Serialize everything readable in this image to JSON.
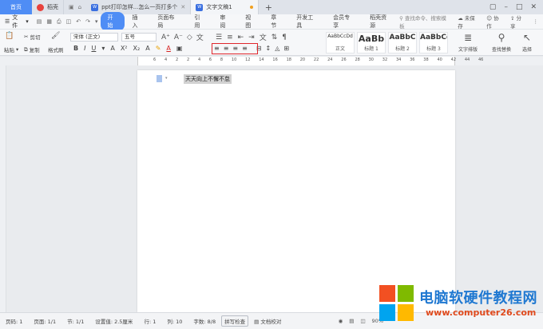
{
  "tabs": {
    "home": "首页",
    "items": [
      {
        "label": "稻壳",
        "icon": "docer-icon"
      },
      {
        "label": "ppt打印怎样...怎么一页打多个",
        "icon": "wps-writer-icon"
      },
      {
        "label": "文字文稿1",
        "icon": "wps-writer-icon"
      }
    ],
    "add": "+"
  },
  "menubar": {
    "file": "文件",
    "items": [
      "开始",
      "插入",
      "页面布局",
      "引用",
      "审阅",
      "视图",
      "章节",
      "开发工具",
      "会员专享",
      "稻壳资源"
    ],
    "active_index": 0,
    "search": "查找命令、搜索模板",
    "status": "未保存",
    "collab": "协作",
    "share": "分享"
  },
  "ribbon": {
    "cut": "剪切",
    "paste": "粘贴",
    "copy": "复制",
    "format_painter": "格式刷",
    "font_name": "宋体 (正文)",
    "font_size": "五号",
    "styles": [
      {
        "sample": "AaBbCcDd",
        "name": "正文"
      },
      {
        "sample": "AaBb",
        "name": "标题 1"
      },
      {
        "sample": "AaBbC",
        "name": "标题 2"
      },
      {
        "sample": "AaBbCc",
        "name": "标题 3"
      }
    ],
    "text_layout": "文字排版",
    "find_replace": "查找替换",
    "select": "选择"
  },
  "ruler": {
    "ticks": [
      "6",
      "4",
      "2",
      "2",
      "4",
      "6",
      "8",
      "10",
      "12",
      "14",
      "16",
      "18",
      "20",
      "22",
      "24",
      "26",
      "28",
      "30",
      "32",
      "34",
      "36",
      "38",
      "40",
      "42",
      "44",
      "46"
    ]
  },
  "document": {
    "text": "天天向上不懈不怠"
  },
  "statusbar": {
    "page": "页码: 1",
    "pages": "页面: 1/1",
    "section": "节: 1/1",
    "setting": "设置值: 2.5厘米",
    "row": "行: 1",
    "col": "列: 10",
    "words": "字数: 8/8",
    "spell": "拼写检查",
    "proof": "文档校对",
    "zoom": "90%"
  },
  "watermark": {
    "title": "电脑软硬件教程网",
    "url": "www.computer26.com"
  },
  "colors": {
    "accent": "#4f8df5",
    "highlight_box": "#e0262c",
    "wm_red": "#f25022",
    "wm_green": "#7fba00",
    "wm_blue": "#00a4ef",
    "wm_yellow": "#ffb900"
  }
}
